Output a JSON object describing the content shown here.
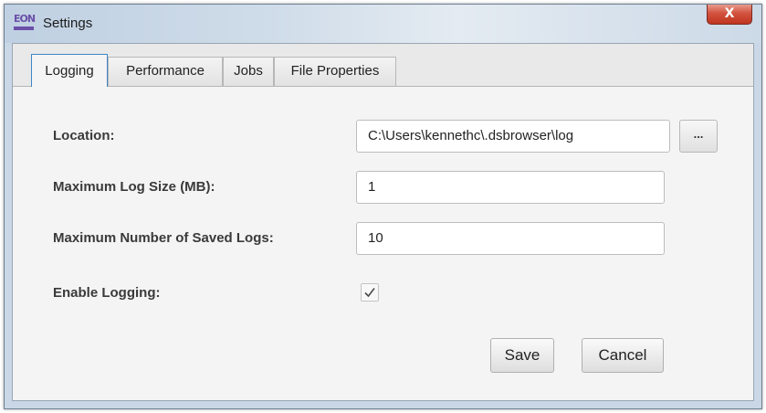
{
  "window": {
    "title": "Settings",
    "app_logo_text": "EON",
    "close_label": "X"
  },
  "tabs": [
    {
      "label": "Logging",
      "active": true
    },
    {
      "label": "Performance",
      "active": false
    },
    {
      "label": "Jobs",
      "active": false
    },
    {
      "label": "File Properties",
      "active": false
    }
  ],
  "logging": {
    "location": {
      "label": "Location:",
      "value": "C:\\Users\\kennethc\\.dsbrowser\\log",
      "browse_label": "..."
    },
    "max_log_size": {
      "label": "Maximum Log Size (MB):",
      "value": "1"
    },
    "max_saved_logs": {
      "label": "Maximum Number of Saved Logs:",
      "value": "10"
    },
    "enable_logging": {
      "label": "Enable Logging:",
      "checked": true
    }
  },
  "buttons": {
    "save": "Save",
    "cancel": "Cancel"
  },
  "colors": {
    "active_tab_border": "#3c86c7",
    "close_button": "#c7422e",
    "logo": "#6b4fa8"
  }
}
